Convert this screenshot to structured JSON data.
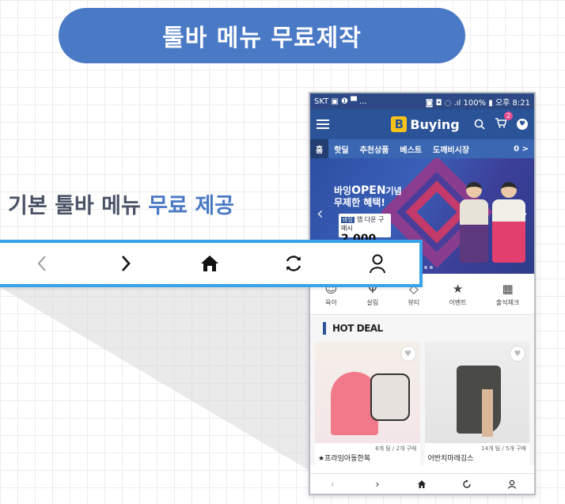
{
  "header": {
    "title": "툴바 메뉴 무료제작"
  },
  "subtitle": {
    "lead": "기본 툴바 메뉴 ",
    "accent": "무료 제공"
  },
  "phone": {
    "status": {
      "left": "SKT ▣ ❶ ▀ ...",
      "right": "◙ ◘ ◌ .ıl 100% ▮ 오후 8:21"
    },
    "brand": {
      "mark": "B",
      "name": "Buying"
    },
    "cart_count": "2",
    "tabs": [
      "홈",
      "핫딜",
      "추천상품",
      "베스트",
      "도깨비시장",
      "0 >"
    ],
    "banner": {
      "line1_a": "바잉",
      "line1_b": "OPEN",
      "line1_c": "기념",
      "line2": "무제한 혜택!",
      "card_tag": "바잉",
      "card_text": "앱 다운 구매시",
      "price": "2,000"
    },
    "categories": [
      {
        "label": "육아",
        "icon": "baby-icon",
        "glyph": "☺"
      },
      {
        "label": "살림",
        "icon": "utensils-icon",
        "glyph": "Ψ"
      },
      {
        "label": "뷰티",
        "icon": "diamond-icon",
        "glyph": "◇"
      },
      {
        "label": "이벤트",
        "icon": "star-icon",
        "glyph": "★"
      },
      {
        "label": "출석체크",
        "icon": "calendar-icon",
        "glyph": "▦"
      }
    ],
    "hotdeal_label": "HOT DEAL",
    "products": [
      {
        "meta": "8개 팀 / 2개 구매",
        "name": "★프라임아동한복"
      },
      {
        "meta": "14개 팀 / 5개 구매",
        "name": "어반치마레깅스"
      }
    ]
  },
  "toolbar": {
    "items": [
      {
        "name": "back",
        "icon": "chevron-left-icon",
        "glyph": "‹"
      },
      {
        "name": "forward",
        "icon": "chevron-right-icon",
        "glyph": "›"
      },
      {
        "name": "home",
        "icon": "home-icon",
        "glyph": "⌂"
      },
      {
        "name": "refresh",
        "icon": "refresh-icon",
        "glyph": "⟳"
      },
      {
        "name": "profile",
        "icon": "person-icon",
        "glyph": "♙"
      }
    ]
  },
  "colors": {
    "pill": "#4a79c5",
    "appbar": "#2b5397",
    "toolbar_border": "#38a3e8",
    "accent_text": "#4a79c5"
  }
}
